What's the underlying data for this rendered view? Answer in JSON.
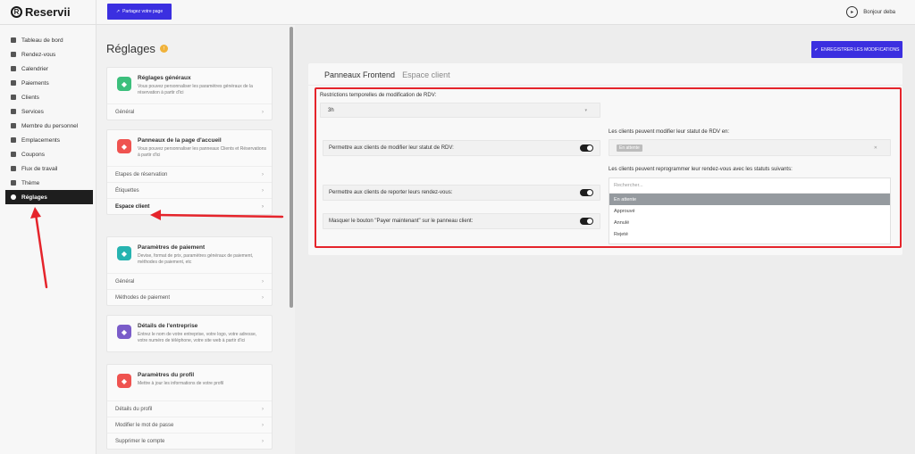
{
  "sidebar": {
    "logo_mark": "R",
    "logo_text": "Reservii",
    "items": [
      {
        "label": "Tableau de bord",
        "icon": "dashboard-icon"
      },
      {
        "label": "Rendez-vous",
        "icon": "clock-icon"
      },
      {
        "label": "Calendrier",
        "icon": "calendar-icon"
      },
      {
        "label": "Paiements",
        "icon": "payments-icon"
      },
      {
        "label": "Clients",
        "icon": "users-icon"
      },
      {
        "label": "Services",
        "icon": "services-icon"
      },
      {
        "label": "Membre du personnel",
        "icon": "staff-icon"
      },
      {
        "label": "Emplacements",
        "icon": "location-icon"
      },
      {
        "label": "Coupons",
        "icon": "coupon-icon"
      },
      {
        "label": "Flux de travail",
        "icon": "workflow-icon"
      },
      {
        "label": "Thème",
        "icon": "theme-icon"
      },
      {
        "label": "Réglages",
        "icon": "gear-icon"
      }
    ],
    "active_index": 11
  },
  "topbar": {
    "share_label": "Partagez votre page",
    "user_greeting": "Bonjour deba"
  },
  "settings": {
    "title": "Réglages",
    "cards": [
      {
        "title": "Réglages généraux",
        "desc": "Vous pouvez personnaliser les paramètres généraux de la réservation à partir d'ici",
        "color": "#3cbf7c",
        "icon": "settings-icon",
        "rows": [
          "Général"
        ]
      },
      {
        "title": "Panneaux de la page d'accueil",
        "desc": "Vous pouvez personnaliser les panneaux Clients et Réservations à partir d'ici",
        "color": "#ef5350",
        "icon": "panels-icon",
        "rows": [
          "Etapes de réservation",
          "Étiquettes",
          "Espace client"
        ]
      },
      {
        "title": "Paramètres de paiement",
        "desc": "Devise, format de prix, paramètres généraux de paiement, méthodes de paiement, etc",
        "color": "#26b3b0",
        "icon": "wallet-icon",
        "rows": [
          "Général",
          "Méthodes de paiement"
        ]
      },
      {
        "title": "Détails de l'entreprise",
        "desc": "Entrez le nom de votre entreprise, votre logo, votre adresse, votre numéro de téléphone, votre site web à partir d'ici",
        "color": "#7a5cc9",
        "icon": "building-icon",
        "rows": []
      },
      {
        "title": "Paramètres du profil",
        "desc": "Mettre à jour les informations de votre profil",
        "color": "#ef5350",
        "icon": "profile-icon",
        "rows": [
          "Détails du profil",
          "Modifier le mot de passe",
          "Supprimer le compte"
        ]
      }
    ],
    "active_row": "Espace client"
  },
  "main": {
    "save_label": "ENREGISTRER LES MODIFICATIONS",
    "breadcrumb_main": "Panneaux Frontend",
    "breadcrumb_sub": "Espace client",
    "restriction_label": "Restrictions temporelles de modification de RDV:",
    "restriction_value": "3h",
    "toggles": [
      {
        "label": "Permettre aux clients de modifier leur statut de RDV:",
        "on": true
      },
      {
        "label": "Permettre aux clients de reporter leurs rendez-vous:",
        "on": true
      },
      {
        "label": "Masquer le bouton \"Payer maintenant\" sur le panneau client:",
        "on": true
      }
    ],
    "status_label": "Les clients peuvent modifier leur statut de RDV en:",
    "status_tag": "En attente",
    "reschedule_label": "Les clients peuvent reprogrammer leur rendez-vous avec les statuts suivants:",
    "search_placeholder": "Rechercher...",
    "options": [
      "En attente",
      "Approuvé",
      "Annulé",
      "Rejeté"
    ],
    "highlighted_option": 0
  },
  "colors": {
    "accent": "#3b2fe0",
    "highlight_box": "#e5242b",
    "active_nav": "#1e1e1e"
  }
}
